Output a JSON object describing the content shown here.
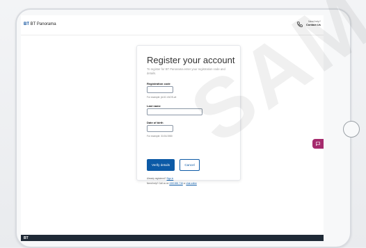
{
  "header": {
    "logo_text": "BT Panorama",
    "logo_prefix": "BT",
    "support": {
      "need_help": "Need help?",
      "contact_us": "Contact Us"
    }
  },
  "card": {
    "title": "Register your account",
    "subtitle": "To register for BT Panorama enter your registration code and details.",
    "fields": {
      "registration_code": {
        "label": "Registration code",
        "value": "",
        "hint": "For example: jA1G-VUOS-wt"
      },
      "last_name": {
        "label": "Last name",
        "value": ""
      },
      "dob": {
        "label": "Date of birth",
        "value": "",
        "hint": "For example: 31/01/1980"
      }
    },
    "buttons": {
      "verify": "Verify details",
      "cancel": "Cancel"
    },
    "footer_links": {
      "registered_prefix": "Already registered?",
      "sign_in": "Sign in",
      "help_prefix": "Need help? Call us on",
      "phone": "1300 881 716",
      "help_suffix": "or",
      "chat": "chat online"
    }
  },
  "footer": {
    "logo": "BT"
  },
  "watermark": "SAM",
  "colors": {
    "primary": "#0c5aa6",
    "chat": "#a52a6d",
    "footer": "#1f2a36"
  },
  "icons": [
    "phone-icon",
    "chat-icon"
  ]
}
